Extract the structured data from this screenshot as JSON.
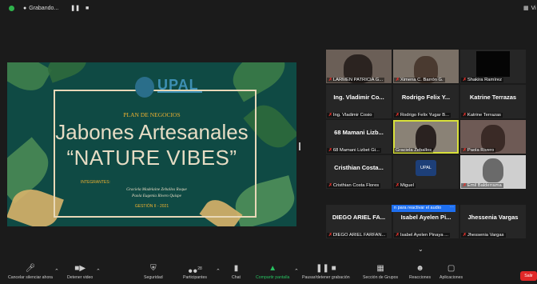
{
  "topbar": {
    "status": "Grabando...",
    "view": "Vi"
  },
  "slide": {
    "logo": "UPAL",
    "plan": "PLAN DE NEGOCIOS",
    "title_line1": "Jabones Artesanales",
    "title_line2": "“NATURE VIBES”",
    "integrantes_label": "INTEGRANTES:",
    "member1": "Graciela Madelaine Zeballos Roque",
    "member2": "Paola Eugenia Rivero Quispe",
    "gestion": "GESTIÓN II - 2021"
  },
  "gallery": {
    "r1": [
      {
        "label": "LARMEN PATRICIA G..."
      },
      {
        "label": "Ximena C. Barrón G."
      },
      {
        "label": "Shakira Ramírez"
      }
    ],
    "r2": [
      {
        "name": "Ing. Vladimir Co...",
        "label": "Ing. Vladimir Cosio"
      },
      {
        "name": "Rodrigo Felix Y...",
        "label": "Rodrigo Felix Yugar B..."
      },
      {
        "name": "Katrine Terrazas",
        "label": "Katrine Terrazas"
      }
    ],
    "r3": [
      {
        "name": "68 Mamani Lizb...",
        "label": "68 Mamani Lizbet Gi..."
      },
      {
        "label": "Graciela Zeballos"
      },
      {
        "label": "Paola Rivero"
      }
    ],
    "r4": [
      {
        "name": "Cristhian Costa...",
        "label": "Cristhian Costa Flores"
      },
      {
        "label": "Miguel",
        "logo": "UPAL"
      },
      {
        "label": "Emil Balderrama"
      }
    ],
    "r5": [
      {
        "name": "DIEGO ARIEL FA...",
        "label": "DIEGO ARIEL FARFAN..."
      },
      {
        "name": "Isabel Ayelen Pi...",
        "label": "Isabel Ayelen Pinaya ..."
      },
      {
        "name": "Jhessenia Vargas",
        "label": "Jhessenia Vargas"
      }
    ],
    "banner": "n para reactivar el audio"
  },
  "toolbar": {
    "mute": "Cancelar silenciar ahora",
    "video": "Detener video",
    "security": "Seguridad",
    "participants": "Participantes",
    "participants_count": "28",
    "chat": "Chat",
    "share": "Compartir pantalla",
    "record": "Pausar/detener grabación",
    "rooms": "Sección de Grupos",
    "reactions": "Reacciones",
    "apps": "Aplicaciones",
    "leave": "Salir"
  },
  "colors": {
    "slide_bg": "#0f4a44",
    "accent_gold": "#f0b230",
    "mic_red": "#e0302a",
    "share_green": "#28c060",
    "leave_red": "#e02828"
  }
}
